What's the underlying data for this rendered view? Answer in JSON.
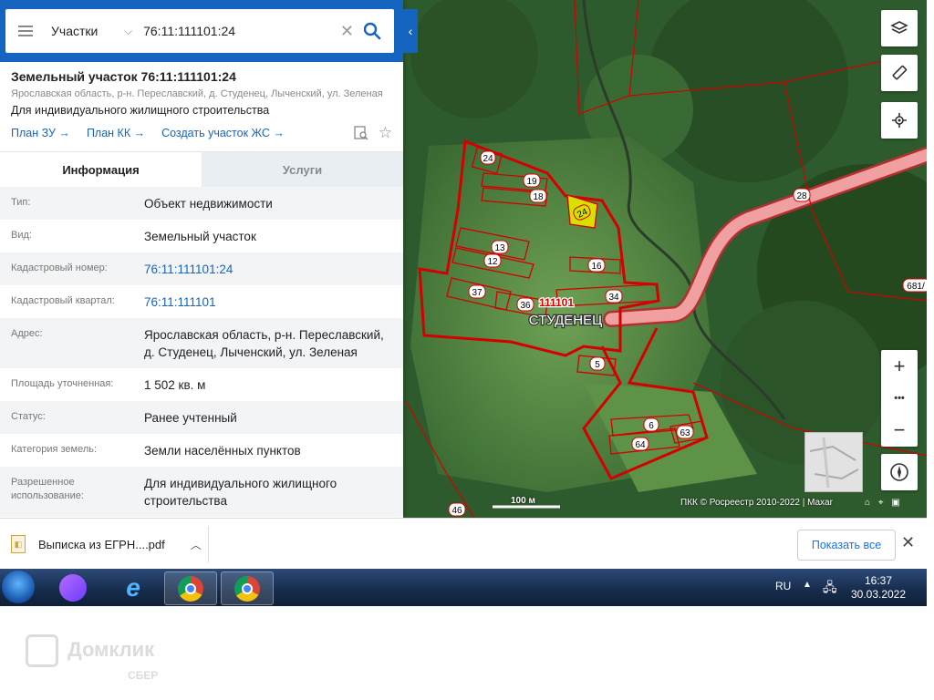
{
  "search": {
    "layer": "Участки",
    "query": "76:11:111101:24"
  },
  "object": {
    "title": "Земельный участок 76:11:111101:24",
    "address": "Ярославская область, р-н. Переславский, д. Студенец, Лыченский, ул. Зеленая",
    "purpose": "Для индивидуального жилищного строительства",
    "links": [
      "План ЗУ →",
      "План КК →",
      "Создать участок ЖС →"
    ]
  },
  "tabs": [
    "Информация",
    "Услуги"
  ],
  "info_rows": [
    {
      "key": "Тип:",
      "value": "Объект недвижимости"
    },
    {
      "key": "Вид:",
      "value": "Земельный участок"
    },
    {
      "key": "Кадастровый номер:",
      "value": "76:11:111101:24"
    },
    {
      "key": "Кадастровый квартал:",
      "value": "76:11:111101"
    },
    {
      "key": "Адрес:",
      "value": "Ярославская область, р-н. Переславский, д. Студенец, Лыченский, ул. Зеленая"
    },
    {
      "key": "Площадь уточненная:",
      "value": "1 502 кв. м"
    },
    {
      "key": "Статус:",
      "value": "Ранее учтенный"
    },
    {
      "key": "Категория земель:",
      "value": "Земли населённых пунктов"
    },
    {
      "key": "Разрешенное использование:",
      "value": "Для индивидуального жилищного строительства"
    }
  ],
  "map": {
    "block_label": "111101",
    "village_label": "СТУДЕНЕЦ",
    "road_label": "28",
    "edge_label": "681/",
    "parcel_labels": [
      "24",
      "19",
      "18",
      "13",
      "12",
      "16",
      "37",
      "36",
      "34",
      "5",
      "6",
      "63",
      "64",
      "46",
      "24"
    ],
    "scale": "100 м",
    "attribution": "ПКК © Росреестр 2010-2022 | Maxar",
    "zoom_in": "+",
    "zoom_more": "•••",
    "zoom_out": "−"
  },
  "download": {
    "file": "Выписка из ЕГРН....pdf",
    "show_all": "Показать все"
  },
  "taskbar": {
    "lang": "RU",
    "time": "16:37",
    "date": "30.03.2022"
  },
  "watermark": {
    "brand": "Домклик",
    "sub": "СБЕР"
  },
  "colors": {
    "accent": "#1565c0",
    "parcel_border": "#d40000",
    "selected_parcel": "#d8e000",
    "road": "#f0a0a0"
  }
}
